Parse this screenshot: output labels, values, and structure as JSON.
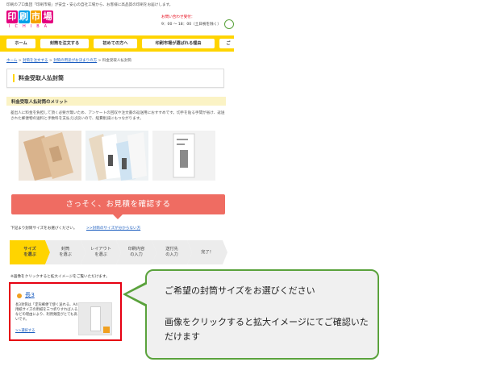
{
  "header": {
    "topline": "印刷のプロ集団「印刷市場」が安全・安心の自社工場から、お客様に高品質の印刷をお届けします。",
    "logo_text": [
      "印",
      "刷",
      "市",
      "場"
    ],
    "logo_colors": [
      "#e4007f",
      "#00a0e9",
      "#f5a200",
      "#e4007f"
    ],
    "logo_sub": "ICHIBA",
    "contact_label": "お問い合わせ受付：",
    "contact_hours": "9：00 ～ 18：00（土日祝を除く）"
  },
  "nav": {
    "items": [
      "ホーム",
      "封筒を注文する",
      "初めての方へ",
      "印刷市場が選ばれる理由",
      "ご"
    ]
  },
  "breadcrumb": {
    "home": "ホーム",
    "order": "封筒を注文する",
    "usage": "封筒の用途がお決まりの方",
    "current": "料金受取人払封筒",
    "separator": ">"
  },
  "page": {
    "title": "料金受取人払封筒",
    "merit_heading": "料金受取人払封筒のメリット",
    "description": "差出人に料金を負担して頂く必要が無いため、アンケートの回収や注文書の返送用におすすめです。切手を貼る手間が省け、返送された郵便物の送料と手数料を支払えば良いので、経費削減にもつながります。",
    "cta_label": "さっそく、お見積を確認する",
    "size_note": "下記より封筒サイズをお選びください。",
    "size_help_link": ">>封筒のサイズが分からない方",
    "image_note": "※画像をクリックすると拡大イメージをご覧いただけます。"
  },
  "steps": [
    {
      "line1": "サイズ",
      "line2": "を選ぶ",
      "active": true
    },
    {
      "line1": "封筒",
      "line2": "を選ぶ",
      "active": false
    },
    {
      "line1": "レイアウト",
      "line2": "を選ぶ",
      "active": false
    },
    {
      "line1": "印刷内容",
      "line2": "の入力",
      "active": false
    },
    {
      "line1": "送付先",
      "line2": "の入力",
      "active": false
    },
    {
      "line1": "完了！",
      "line2": "",
      "active": false
    }
  ],
  "card": {
    "title": "長3",
    "description": "長3封筒は「定形郵便で使く送れる、A4用紙サイズの用紙を三つ折りすれば入る」などの理由により、利用頻度がとても高いです。",
    "link": ">>選択する"
  },
  "callout": {
    "line1": "ご希望の封筒サイズをお選びください",
    "line2": "画像をクリックすると拡大イメージにてご確認いただけます"
  },
  "colors": {
    "brand_yellow": "#ffd400",
    "cta_red": "#ef6c62",
    "highlight_red": "#e60012",
    "callout_green": "#5aa23c",
    "step_active": "#ffd400",
    "step_inactive": "#ececec"
  }
}
